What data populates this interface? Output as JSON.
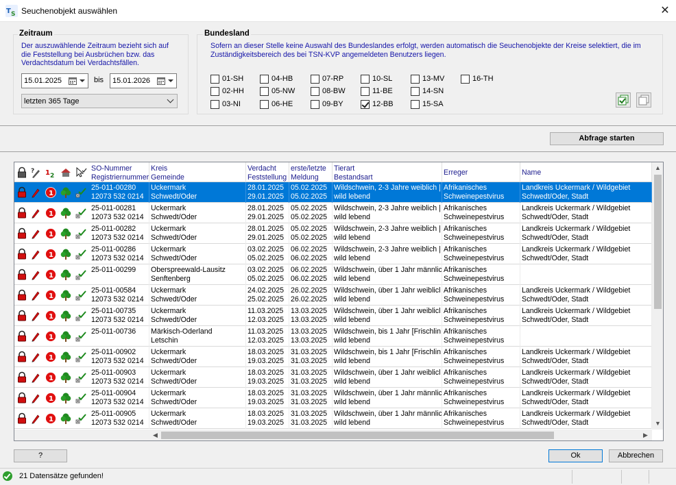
{
  "window": {
    "title": "Seuchenobjekt auswählen",
    "close": "✕"
  },
  "zeitraum": {
    "title": "Zeitraum",
    "description": [
      "Der auszuwählende Zeitraum bezieht sich auf",
      "die Feststellung bei Ausbrüchen bzw. das",
      "Verdachtsdatum bei Verdachtsfällen."
    ],
    "from": "15.01.2025",
    "bis_label": "bis",
    "to": "15.01.2026",
    "period": "letzten 365 Tage"
  },
  "bundesland": {
    "title": "Bundesland",
    "description": [
      "Sofern an dieser Stelle keine Auswahl des Bundeslandes erfolgt, werden automatisch die Seuchenobjekte der Kreise selektiert, die im",
      "Zuständigkeitsbereich des bei TSN-KVP angemeldeten Benutzers liegen."
    ],
    "states": [
      {
        "label": "01-SH",
        "checked": false
      },
      {
        "label": "02-HH",
        "checked": false
      },
      {
        "label": "03-NI",
        "checked": false
      },
      {
        "label": "04-HB",
        "checked": false
      },
      {
        "label": "05-NW",
        "checked": false
      },
      {
        "label": "06-HE",
        "checked": false
      },
      {
        "label": "07-RP",
        "checked": false
      },
      {
        "label": "08-BW",
        "checked": false
      },
      {
        "label": "09-BY",
        "checked": false
      },
      {
        "label": "10-SL",
        "checked": false
      },
      {
        "label": "11-BE",
        "checked": false
      },
      {
        "label": "12-BB",
        "checked": true
      },
      {
        "label": "13-MV",
        "checked": false
      },
      {
        "label": "14-SN",
        "checked": false
      },
      {
        "label": "15-SA",
        "checked": false
      },
      {
        "label": "16-TH",
        "checked": false
      }
    ]
  },
  "query_button": "Abfrage starten",
  "table": {
    "headers": {
      "so": [
        "SO-Nummer",
        "Registriernummer"
      ],
      "kreis": [
        "Kreis",
        "Gemeinde"
      ],
      "verdacht": [
        "Verdacht",
        "Feststellung"
      ],
      "meldung": [
        "erste/letzte",
        "Meldung"
      ],
      "tierart": [
        "Tierart",
        "Bestandsart"
      ],
      "erreger": [
        "Erreger",
        ""
      ],
      "name": [
        "Name",
        ""
      ]
    },
    "rows": [
      {
        "so": "25-011-00280",
        "reg": "12073 532 0214",
        "kreis": "Uckermark",
        "gemeinde": "Schwedt/Oder",
        "d1": "28.01.2025",
        "d2": "29.01.2025",
        "m1": "05.02.2025",
        "m2": "05.02.2025",
        "tier": "Wildschwein, 2-3 Jahre weiblich |",
        "best": "wild lebend",
        "err1": "Afrikanisches",
        "err2": "Schweinepestvirus",
        "n1": "Landkreis Uckermark / Wildgebiet",
        "n2": "Schwedt/Oder, Stadt"
      },
      {
        "so": "25-011-00281",
        "reg": "12073 532 0214",
        "kreis": "Uckermark",
        "gemeinde": "Schwedt/Oder",
        "d1": "28.01.2025",
        "d2": "29.01.2025",
        "m1": "05.02.2025",
        "m2": "05.02.2025",
        "tier": "Wildschwein, 2-3 Jahre weiblich |",
        "best": "wild lebend",
        "err1": "Afrikanisches",
        "err2": "Schweinepestvirus",
        "n1": "Landkreis Uckermark / Wildgebiet",
        "n2": "Schwedt/Oder, Stadt"
      },
      {
        "so": "25-011-00282",
        "reg": "12073 532 0214",
        "kreis": "Uckermark",
        "gemeinde": "Schwedt/Oder",
        "d1": "28.01.2025",
        "d2": "29.01.2025",
        "m1": "05.02.2025",
        "m2": "05.02.2025",
        "tier": "Wildschwein, 2-3 Jahre weiblich |",
        "best": "wild lebend",
        "err1": "Afrikanisches",
        "err2": "Schweinepestvirus",
        "n1": "Landkreis Uckermark / Wildgebiet",
        "n2": "Schwedt/Oder, Stadt"
      },
      {
        "so": "25-011-00286",
        "reg": "12073 532 0214",
        "kreis": "Uckermark",
        "gemeinde": "Schwedt/Oder",
        "d1": "03.02.2025",
        "d2": "05.02.2025",
        "m1": "06.02.2025",
        "m2": "06.02.2025",
        "tier": "Wildschwein, 2-3 Jahre weiblich |",
        "best": "wild lebend",
        "err1": "Afrikanisches",
        "err2": "Schweinepestvirus",
        "n1": "Landkreis Uckermark / Wildgebiet",
        "n2": "Schwedt/Oder, Stadt"
      },
      {
        "so": "25-011-00299",
        "reg": "",
        "kreis": "Oberspreewald-Lausitz",
        "gemeinde": "Senftenberg",
        "d1": "03.02.2025",
        "d2": "05.02.2025",
        "m1": "06.02.2025",
        "m2": "06.02.2025",
        "tier": "Wildschwein, über 1 Jahr männlic",
        "best": "wild lebend",
        "err1": "Afrikanisches",
        "err2": "Schweinepestvirus",
        "n1": "",
        "n2": ""
      },
      {
        "so": "25-011-00584",
        "reg": "12073 532 0214",
        "kreis": "Uckermark",
        "gemeinde": "Schwedt/Oder",
        "d1": "24.02.2025",
        "d2": "25.02.2025",
        "m1": "26.02.2025",
        "m2": "26.02.2025",
        "tier": "Wildschwein, über 1 Jahr weiblicl",
        "best": "wild lebend",
        "err1": "Afrikanisches",
        "err2": "Schweinepestvirus",
        "n1": "Landkreis Uckermark / Wildgebiet",
        "n2": "Schwedt/Oder, Stadt"
      },
      {
        "so": "25-011-00735",
        "reg": "12073 532 0214",
        "kreis": "Uckermark",
        "gemeinde": "Schwedt/Oder",
        "d1": "11.03.2025",
        "d2": "12.03.2025",
        "m1": "13.03.2025",
        "m2": "13.03.2025",
        "tier": "Wildschwein, über 1 Jahr weiblicl",
        "best": "wild lebend",
        "err1": "Afrikanisches",
        "err2": "Schweinepestvirus",
        "n1": "Landkreis Uckermark / Wildgebiet",
        "n2": "Schwedt/Oder, Stadt"
      },
      {
        "so": "25-011-00736",
        "reg": "",
        "kreis": "Märkisch-Oderland",
        "gemeinde": "Letschin",
        "d1": "11.03.2025",
        "d2": "12.03.2025",
        "m1": "13.03.2025",
        "m2": "13.03.2025",
        "tier": "Wildschwein, bis 1 Jahr [Frischlin",
        "best": "wild lebend",
        "err1": "Afrikanisches",
        "err2": "Schweinepestvirus",
        "n1": "",
        "n2": ""
      },
      {
        "so": "25-011-00902",
        "reg": "12073 532 0214",
        "kreis": "Uckermark",
        "gemeinde": "Schwedt/Oder",
        "d1": "18.03.2025",
        "d2": "19.03.2025",
        "m1": "31.03.2025",
        "m2": "31.03.2025",
        "tier": "Wildschwein, bis 1 Jahr [Frischlin",
        "best": "wild lebend",
        "err1": "Afrikanisches",
        "err2": "Schweinepestvirus",
        "n1": "Landkreis Uckermark / Wildgebiet",
        "n2": "Schwedt/Oder, Stadt"
      },
      {
        "so": "25-011-00903",
        "reg": "12073 532 0214",
        "kreis": "Uckermark",
        "gemeinde": "Schwedt/Oder",
        "d1": "18.03.2025",
        "d2": "19.03.2025",
        "m1": "31.03.2025",
        "m2": "31.03.2025",
        "tier": "Wildschwein, über 1 Jahr weiblicl",
        "best": "wild lebend",
        "err1": "Afrikanisches",
        "err2": "Schweinepestvirus",
        "n1": "Landkreis Uckermark / Wildgebiet",
        "n2": "Schwedt/Oder, Stadt"
      },
      {
        "so": "25-011-00904",
        "reg": "12073 532 0214",
        "kreis": "Uckermark",
        "gemeinde": "Schwedt/Oder",
        "d1": "18.03.2025",
        "d2": "19.03.2025",
        "m1": "31.03.2025",
        "m2": "31.03.2025",
        "tier": "Wildschwein, über 1 Jahr männlic",
        "best": "wild lebend",
        "err1": "Afrikanisches",
        "err2": "Schweinepestvirus",
        "n1": "Landkreis Uckermark / Wildgebiet",
        "n2": "Schwedt/Oder, Stadt"
      },
      {
        "so": "25-011-00905",
        "reg": "12073 532 0214",
        "kreis": "Uckermark",
        "gemeinde": "Schwedt/Oder",
        "d1": "18.03.2025",
        "d2": "19.03.2025",
        "m1": "31.03.2025",
        "m2": "31.03.2025",
        "tier": "Wildschwein, über 1 Jahr männlic",
        "best": "wild lebend",
        "err1": "Afrikanisches",
        "err2": "Schweinepestvirus",
        "n1": "Landkreis Uckermark / Wildgebiet",
        "n2": "Schwedt/Oder, Stadt"
      }
    ]
  },
  "buttons": {
    "help": "?",
    "ok": "Ok",
    "cancel": "Abbrechen"
  },
  "status": "21 Datensätze gefunden!",
  "icons": [
    "lock-icon",
    "pen-icon",
    "ordinal-12-icon",
    "badge-one-icon",
    "tree-icon",
    "check-cursor-icon"
  ]
}
